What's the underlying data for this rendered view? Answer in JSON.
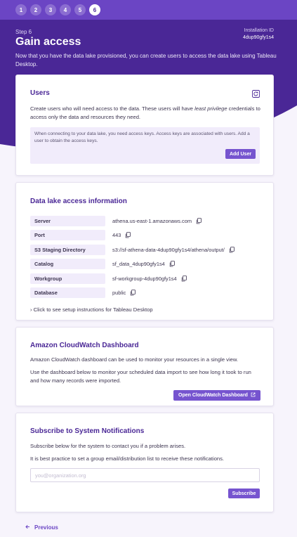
{
  "steps": [
    "1",
    "2",
    "3",
    "4",
    "5",
    "6"
  ],
  "active_step": "6",
  "header": {
    "step_label": "Step 6",
    "title": "Gain access",
    "installation_label": "Installation ID",
    "installation_id": "4dup90gfy1s4",
    "intro": "Now that you have the data lake provisioned, you can create users to access the data lake using Tableau Desktop."
  },
  "users": {
    "title": "Users",
    "desc_before": "Create users who will need access to the data. These users will have ",
    "desc_emphasis": "least privilege",
    "desc_after": " credentials to access only the data and resources they need.",
    "info": "When connecting to your data lake, you need access keys. Access keys are associated with users. Add a user to obtain the access keys.",
    "add_button": "Add User"
  },
  "datalake": {
    "title": "Data lake access information",
    "rows": [
      {
        "key": "Server",
        "value": "athena.us-east-1.amazonaws.com"
      },
      {
        "key": "Port",
        "value": "443"
      },
      {
        "key": "S3 Staging Directory",
        "value": "s3://sf-athena-data-4dup90gfy1s4/athena/output/"
      },
      {
        "key": "Catalog",
        "value": "sf_data_4dup90gfy1s4"
      },
      {
        "key": "Workgroup",
        "value": "sf-workgroup-4dup90gfy1s4"
      },
      {
        "key": "Database",
        "value": "public"
      }
    ],
    "setup_link": "› Click to see setup instructions for Tableau Desktop"
  },
  "cloudwatch": {
    "title": "Amazon CloudWatch Dashboard",
    "desc1": "Amazon CloudWatch dashboard can be used to monitor your resources in a single view.",
    "desc2": "Use the dashboard below to monitor your scheduled data import to see how long it took to run and how many records were imported.",
    "button": "Open CloudWatch Dashboard"
  },
  "notifications": {
    "title": "Subscribe to System Notifications",
    "desc1": "Subscribe below for the system to contact you if a problem arises.",
    "desc2": "It is best practice to set a group email/distribution list to receive these notifications.",
    "email_placeholder": "you@organization.org",
    "email_value": "",
    "button": "Subscribe"
  },
  "footer": {
    "previous": "Previous"
  },
  "colors": {
    "hero": "#4a2796",
    "stepbar": "#6b45c4",
    "accent": "#7654cf",
    "heading": "#4a2796",
    "key_bg": "#f1ecfb"
  },
  "icons": {
    "refresh": "refresh-icon",
    "copy": "copy-icon",
    "external": "external-link-icon",
    "previous": "arrow-left-icon"
  }
}
